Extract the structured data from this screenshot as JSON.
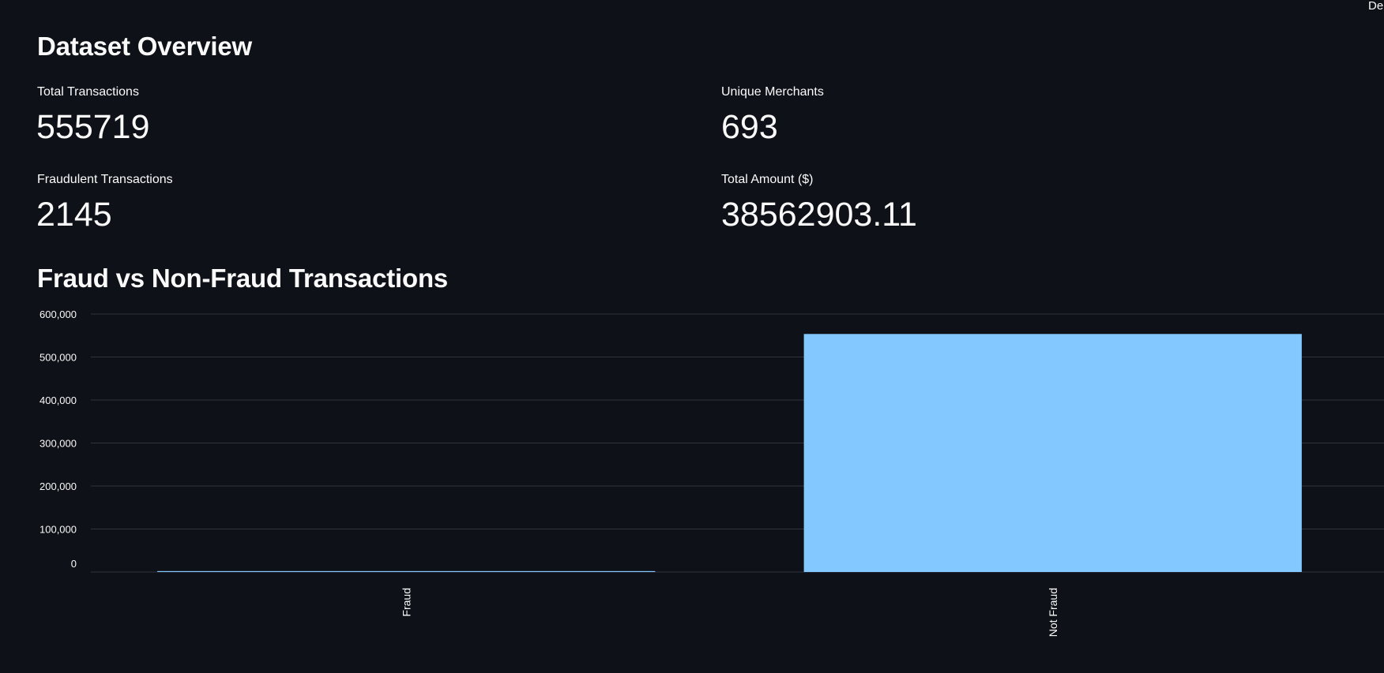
{
  "header": {
    "corner_text": "De"
  },
  "overview": {
    "title": "Dataset Overview",
    "metrics": [
      {
        "label": "Total Transactions",
        "value": "555719"
      },
      {
        "label": "Unique Merchants",
        "value": "693"
      },
      {
        "label": "Fraudulent Transactions",
        "value": "2145"
      },
      {
        "label": "Total Amount ($)",
        "value": "38562903.11"
      }
    ]
  },
  "chart_section": {
    "title": "Fraud vs Non-Fraud Transactions"
  },
  "colors": {
    "background": "#0e1117",
    "bar": "#83c9ff",
    "grid": "#31333f",
    "text": "#fafafa"
  },
  "chart_data": {
    "type": "bar",
    "categories": [
      "Fraud",
      "Not Fraud"
    ],
    "values": [
      2145,
      553574
    ],
    "ylim": [
      0,
      600000
    ],
    "yticks": [
      0,
      100000,
      200000,
      300000,
      400000,
      500000,
      600000
    ],
    "ytick_labels": [
      "0",
      "100,000",
      "200,000",
      "300,000",
      "400,000",
      "500,000",
      "600,000"
    ],
    "xlabel": "",
    "ylabel": "",
    "grid": true
  }
}
